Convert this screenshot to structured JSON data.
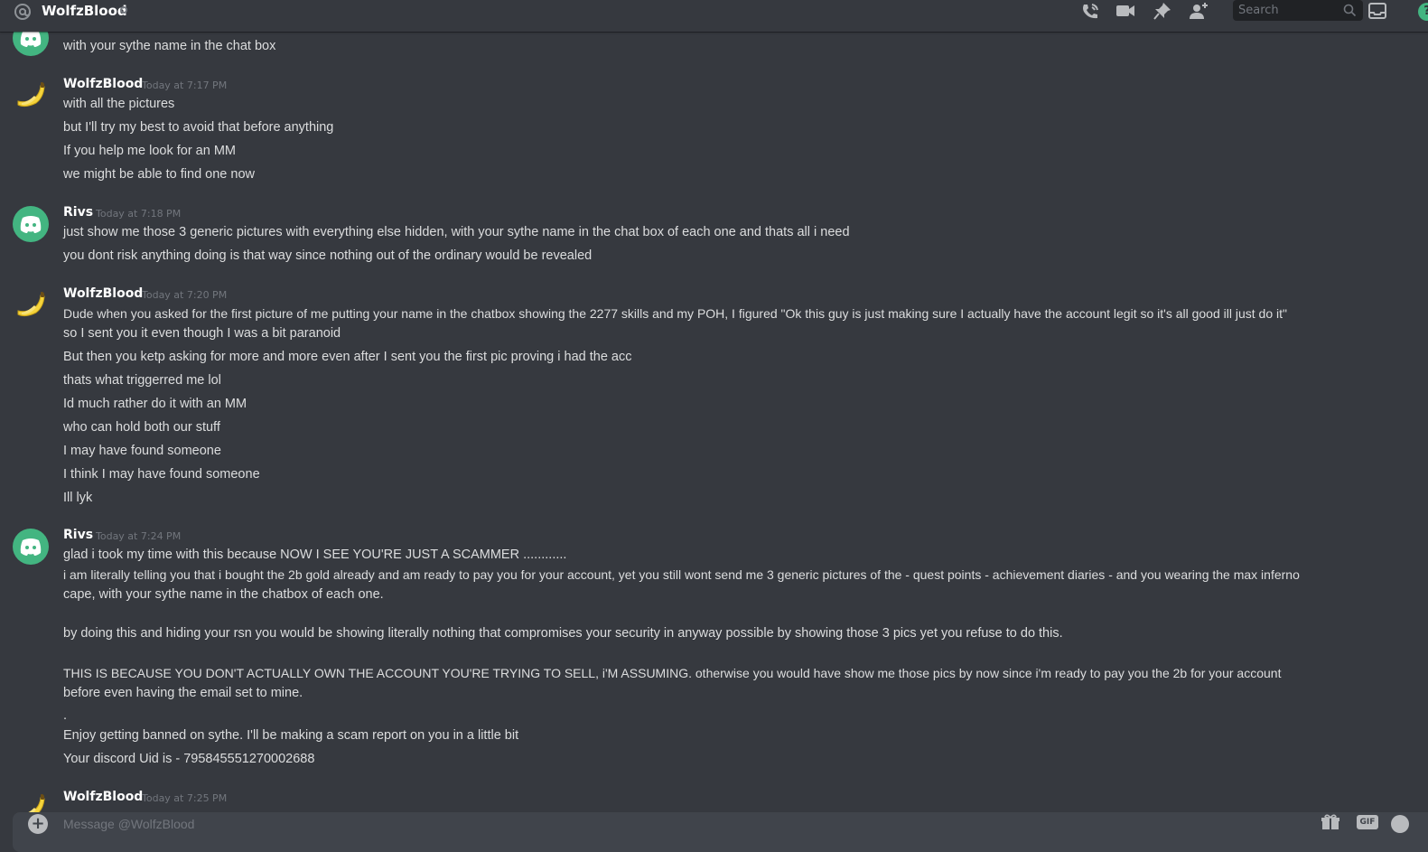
{
  "header": {
    "channel_name": "WolfzBlood",
    "search_placeholder": "Search",
    "help_label": "?"
  },
  "messages": [
    {
      "lines": [
        "with your sythe name in the chat box"
      ]
    },
    {
      "author": "WolfzBlood",
      "timestamp": "Today at 7:17 PM",
      "lines": [
        "with all the pictures",
        "but I'll try my best to avoid that before anything",
        "If you help me look for an MM",
        "we might be able to find one now"
      ]
    },
    {
      "author": "Rivs",
      "timestamp": "Today at 7:18 PM",
      "lines": [
        "just show me those 3 generic pictures with everything else hidden, with your sythe name in the chat box of each one and thats all i need",
        "you dont risk anything doing is that way since nothing out of the ordinary would be revealed"
      ]
    },
    {
      "author": "WolfzBlood",
      "timestamp": "Today at 7:20 PM",
      "lines": [
        "Dude when you asked for the first picture of me putting your name in the chatbox showing the 2277 skills and my POH, I figured \"Ok this guy is just making sure I actually have the account legit so it's all good ill just do it\"",
        "so I sent you it even though I was a bit paranoid",
        "But then you ketp asking for more and more even after I sent you the first pic proving i had the acc",
        "thats what triggerred me lol",
        "Id much rather do it with an MM",
        "who can hold both our stuff",
        "I may have found someone",
        "I think I may have found someone",
        "Ill lyk"
      ]
    },
    {
      "author": "Rivs",
      "timestamp": "Today at 7:24 PM",
      "lines": [
        "glad i took my time with this because NOW I SEE YOU'RE JUST A SCAMMER ............",
        "i am literally telling you that i bought the 2b gold already and am ready to pay you for your account, yet you still wont send me 3 generic pictures of the - quest points - achievement diaries - and you wearing the max inferno",
        "cape, with your sythe name in the chatbox of each one.",
        "by doing this and hiding your rsn you would be showing literally nothing that compromises your security in anyway possible by showing those 3 pics yet you refuse to do this.",
        "THIS IS BECAUSE YOU DON'T ACTUALLY OWN THE ACCOUNT YOU'RE TRYING TO SELL, i'M ASSUMING. otherwise you would have show me those pics by now since i'm ready to pay you the 2b for your account",
        "before even having the email set to mine.",
        ".",
        "Enjoy getting banned on sythe. I'll be making a scam report on you in a little bit",
        "Your discord Uid is - 795845551270002688"
      ]
    },
    {
      "author": "WolfzBlood",
      "timestamp": "Today at 7:25 PM",
      "lines": []
    }
  ],
  "composer": {
    "placeholder": "Message @WolfzBlood",
    "gif_label": "GIF"
  }
}
